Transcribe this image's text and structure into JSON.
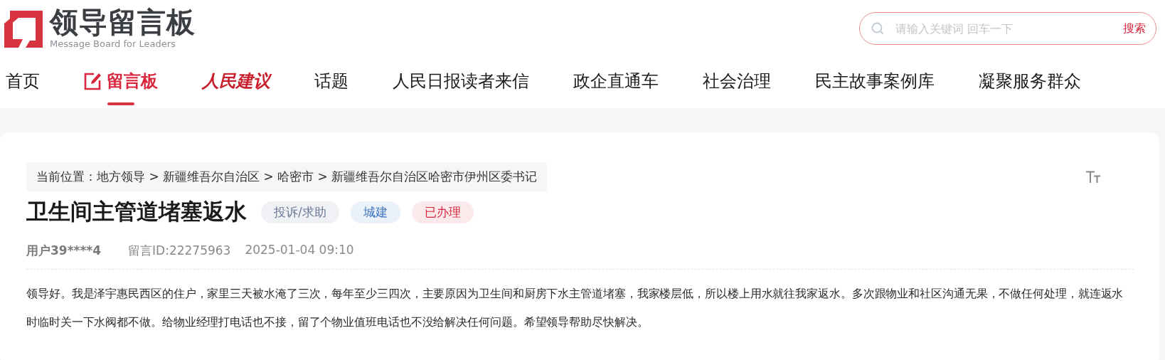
{
  "logo": {
    "title": "领导留言板",
    "subtitle": "Message Board for Leaders"
  },
  "search": {
    "placeholder": "请输入关键词 回车一下",
    "button": "搜索"
  },
  "nav": [
    {
      "label": "首页",
      "kind": "plain",
      "selected": false
    },
    {
      "label": "留言板",
      "kind": "board",
      "selected": true
    },
    {
      "label": "人民建议",
      "kind": "script",
      "selected": false
    },
    {
      "label": "话题",
      "kind": "plain",
      "selected": false
    },
    {
      "label": "人民日报读者来信",
      "kind": "plain",
      "selected": false
    },
    {
      "label": "政企直通车",
      "kind": "plain",
      "selected": false
    },
    {
      "label": "社会治理",
      "kind": "plain",
      "selected": false
    },
    {
      "label": "民主故事案例库",
      "kind": "plain",
      "selected": false
    },
    {
      "label": "凝聚服务群众",
      "kind": "plain",
      "selected": false
    }
  ],
  "breadcrumb": "当前位置：地方领导 > 新疆维吾尔自治区 > 哈密市 > 新疆维吾尔自治区哈密市伊州区委书记",
  "message": {
    "title": "卫生间主管道堵塞返水",
    "tags": [
      {
        "label": "投诉/求助",
        "color": "#6b7a99"
      },
      {
        "label": "城建",
        "color": "#3b74c4"
      },
      {
        "label": "已办理",
        "color": "#d7263d"
      }
    ],
    "user": "用户39****4",
    "id": "留言ID:22275963",
    "time": "2025-01-04 09:10",
    "body": "领导好。我是泽宇惠民西区的住户，家里三天被水淹了三次，每年至少三四次，主要原因为卫生间和厨房下水主管道堵塞，我家楼层低，所以楼上用水就往我家返水。多次跟物业和社区沟通无果，不做任何处理，就连返水时临时关一下水阀都不做。给物业经理打电话也不接，留了个物业值班电话也不没给解决任何问题。希望领导帮助尽快解决。"
  }
}
